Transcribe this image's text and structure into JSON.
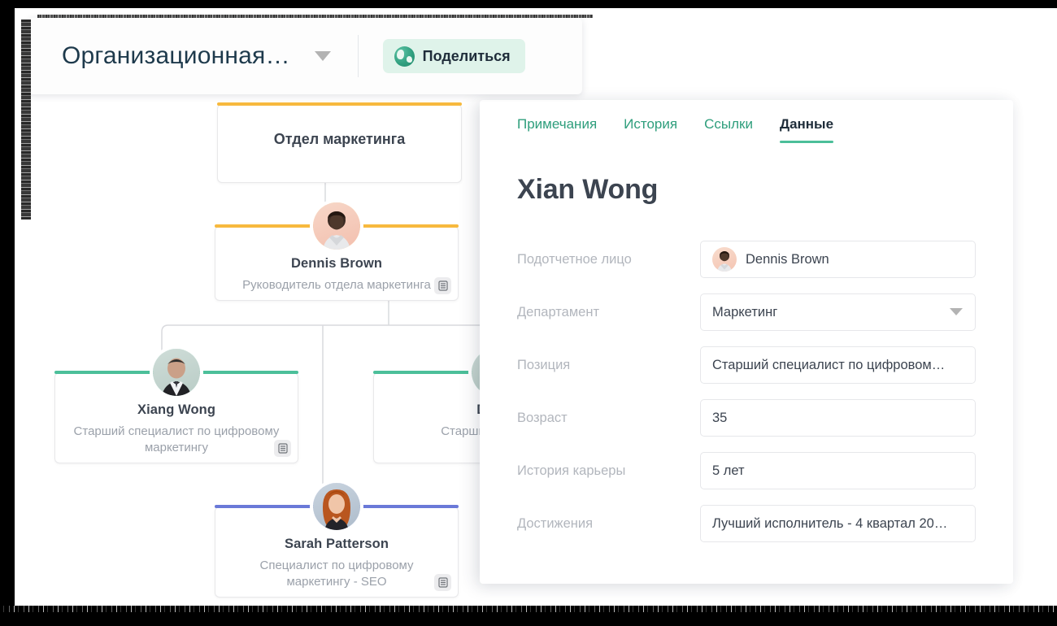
{
  "toolbar": {
    "doc_title": "Организационная…",
    "caret_icon": "chevron-down-icon",
    "share_label": "Поделиться",
    "share_icon": "globe-icon",
    "share_bg": "#dff3ea"
  },
  "chart": {
    "record_icon": "records-icon",
    "nodes": [
      {
        "id": "department",
        "title": "Отдел маркетинга",
        "accent": "#f7b93e",
        "has_avatar": false,
        "has_record_icon": false
      },
      {
        "id": "dennis",
        "name": "Dennis Brown",
        "role": "Руководитель отдела маркетинга",
        "accent": "#f7b93e",
        "avatar_ring": "#f7b93e",
        "has_avatar": true,
        "has_record_icon": true
      },
      {
        "id": "xiang",
        "name": "Xiang Wong",
        "role": "Старший специалист по цифровому маркетингу",
        "accent": "#4cbf9a",
        "avatar_ring": "#4cbf9a",
        "has_avatar": true,
        "has_record_icon": true
      },
      {
        "id": "david",
        "name": "David",
        "role": "Старший специали",
        "accent": "#4cbf9a",
        "avatar_ring": "#4cbf9a",
        "has_avatar": true,
        "has_record_icon": false
      },
      {
        "id": "sarah",
        "name": "Sarah Patterson",
        "role": "Специалист по цифровому маркетингу - SEO",
        "accent": "#6a79d8",
        "avatar_ring": "#6a79d8",
        "has_avatar": true,
        "has_record_icon": true
      }
    ]
  },
  "panel": {
    "tabs": [
      {
        "label": "Примечания",
        "active": false
      },
      {
        "label": "История",
        "active": false
      },
      {
        "label": "Ссылки",
        "active": false
      },
      {
        "label": "Данные",
        "active": true
      }
    ],
    "person_name": "Xian Wong",
    "accent": "#4cbf9a",
    "fields": [
      {
        "label": "Подотчетное лицо",
        "value": "Dennis Brown",
        "type": "avatar"
      },
      {
        "label": "Департамент",
        "value": "Маркетинг",
        "type": "select"
      },
      {
        "label": "Позиция",
        "value": "Старший специалист по цифровом…",
        "type": "text"
      },
      {
        "label": "Возраст",
        "value": "35",
        "type": "text"
      },
      {
        "label": "История карьеры",
        "value": "5 лет",
        "type": "text"
      },
      {
        "label": "Достижения",
        "value": "Лучший исполнитель - 4 квартал 20…",
        "type": "text"
      }
    ]
  }
}
